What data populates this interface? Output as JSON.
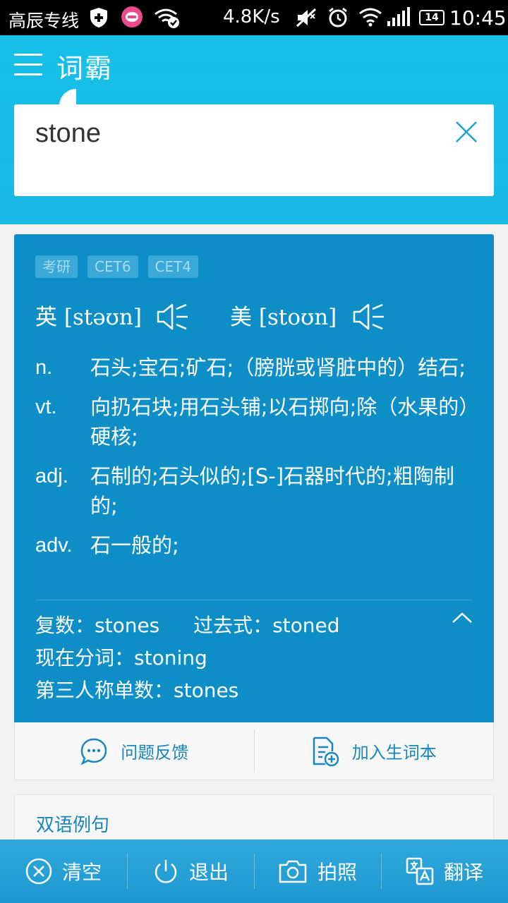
{
  "status_bar": {
    "carrier": "高辰专线",
    "net_speed": "4.8K/s",
    "battery": "14",
    "time": "10:45"
  },
  "header": {
    "app_name": "词霸",
    "search_query": "stone"
  },
  "entry": {
    "tags": [
      "考研",
      "CET6",
      "CET4"
    ],
    "pron_uk": {
      "label": "英",
      "ipa": "[stəʊn]"
    },
    "pron_us": {
      "label": "美",
      "ipa": "[stoʊn]"
    },
    "definitions": [
      {
        "pos": "n.",
        "text": "石头;宝石;矿石;（膀胱或肾脏中的）结石;"
      },
      {
        "pos": "vt.",
        "text": "向扔石块;用石头铺;以石掷向;除（水果的）硬核;"
      },
      {
        "pos": "adj.",
        "text": "石制的;石头似的;[S-]石器时代的;粗陶制的;"
      },
      {
        "pos": "adv.",
        "text": "石一般的;"
      }
    ],
    "forms": {
      "plural": "复数：stones",
      "past": "过去式：stoned",
      "present_participle": "现在分词：stoning",
      "third_person": "第三人称单数：stones"
    }
  },
  "actions": {
    "feedback": "问题反馈",
    "add_wordbook": "加入生词本"
  },
  "examples": {
    "title": "双语例句"
  },
  "toolbar": {
    "clear": "清空",
    "exit": "退出",
    "photo": "拍照",
    "translate": "翻译"
  }
}
